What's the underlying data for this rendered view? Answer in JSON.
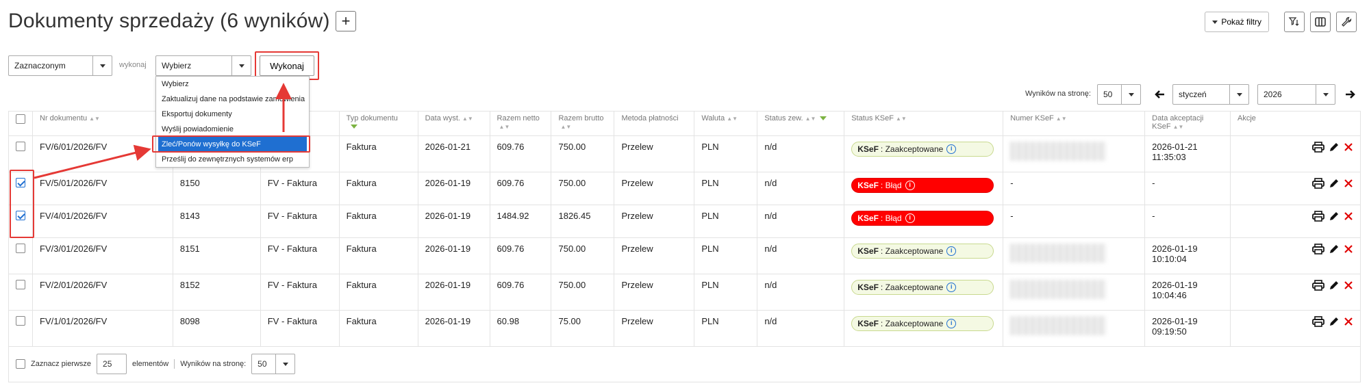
{
  "page": {
    "title": "Dokumenty sprzedaży (6 wyników)",
    "add_label": "+"
  },
  "top_right": {
    "filters_label": "Pokaż filtry"
  },
  "bulk": {
    "scope_value": "Zaznaczonym",
    "action_label": "wykonaj",
    "action_value": "Wybierz",
    "execute_label": "Wykonaj",
    "options": [
      "Wybierz",
      "Zaktualizuj dane na podstawie zamówienia",
      "Eksportuj dokumenty",
      "Wyślij powiadomienie",
      "Zleć/Ponów wysyłkę do KSeF",
      "Prześlij do zewnętrznych systemów erp"
    ],
    "active_option_index": 4
  },
  "pager": {
    "per_page_label": "Wyników na stronę:",
    "per_page_value": "50",
    "month": "styczeń",
    "year": "2026"
  },
  "table": {
    "headers": [
      "Nr dokumentu",
      "",
      "",
      "Typ dokumentu",
      "Data wyst.",
      "Razem netto",
      "Razem brutto",
      "Metoda płatności",
      "Waluta",
      "Status zew.",
      "Status KSeF",
      "Numer KSeF",
      "Data akceptacji KSeF",
      "Akcje"
    ],
    "rows": [
      {
        "checked": false,
        "nr": "FV/6/01/2026/FV",
        "id": "",
        "seria": "ura",
        "typ": "Faktura",
        "data": "2026-01-21",
        "netto": "609.76",
        "brutto": "750.00",
        "metoda": "Przelew",
        "waluta": "PLN",
        "status_zew": "n/d",
        "ksef_status": "ok",
        "ksef_prefix": "KSeF",
        "ksef_text": "Zaakceptowane",
        "numer": "",
        "akcept_date": "2026-01-21",
        "akcept_time": "11:35:03"
      },
      {
        "checked": true,
        "nr": "FV/5/01/2026/FV",
        "id": "8150",
        "seria": "FV - Faktura",
        "typ": "Faktura",
        "data": "2026-01-19",
        "netto": "609.76",
        "brutto": "750.00",
        "metoda": "Przelew",
        "waluta": "PLN",
        "status_zew": "n/d",
        "ksef_status": "err",
        "ksef_prefix": "KSeF",
        "ksef_text": "Błąd",
        "numer": "-",
        "akcept_date": "-",
        "akcept_time": ""
      },
      {
        "checked": true,
        "nr": "FV/4/01/2026/FV",
        "id": "8143",
        "seria": "FV - Faktura",
        "typ": "Faktura",
        "data": "2026-01-19",
        "netto": "1484.92",
        "brutto": "1826.45",
        "metoda": "Przelew",
        "waluta": "PLN",
        "status_zew": "n/d",
        "ksef_status": "err",
        "ksef_prefix": "KSeF",
        "ksef_text": "Błąd",
        "numer": "-",
        "akcept_date": "-",
        "akcept_time": ""
      },
      {
        "checked": false,
        "nr": "FV/3/01/2026/FV",
        "id": "8151",
        "seria": "FV - Faktura",
        "typ": "Faktura",
        "data": "2026-01-19",
        "netto": "609.76",
        "brutto": "750.00",
        "metoda": "Przelew",
        "waluta": "PLN",
        "status_zew": "n/d",
        "ksef_status": "ok",
        "ksef_prefix": "KSeF",
        "ksef_text": "Zaakceptowane",
        "numer": "",
        "akcept_date": "2026-01-19",
        "akcept_time": "10:10:04"
      },
      {
        "checked": false,
        "nr": "FV/2/01/2026/FV",
        "id": "8152",
        "seria": "FV - Faktura",
        "typ": "Faktura",
        "data": "2026-01-19",
        "netto": "609.76",
        "brutto": "750.00",
        "metoda": "Przelew",
        "waluta": "PLN",
        "status_zew": "n/d",
        "ksef_status": "ok",
        "ksef_prefix": "KSeF",
        "ksef_text": "Zaakceptowane",
        "numer": "",
        "akcept_date": "2026-01-19",
        "akcept_time": "10:04:46"
      },
      {
        "checked": false,
        "nr": "FV/1/01/2026/FV",
        "id": "8098",
        "seria": "FV - Faktura",
        "typ": "Faktura",
        "data": "2026-01-19",
        "netto": "60.98",
        "brutto": "75.00",
        "metoda": "Przelew",
        "waluta": "PLN",
        "status_zew": "n/d",
        "ksef_status": "ok",
        "ksef_prefix": "KSeF",
        "ksef_text": "Zaakceptowane",
        "numer": "",
        "akcept_date": "2026-01-19",
        "akcept_time": "09:19:50"
      }
    ]
  },
  "footer": {
    "select_first_label": "Zaznacz pierwsze",
    "select_first_value": "25",
    "elements_label": "elementów",
    "per_page_label": "Wyników na stronę:",
    "per_page_value": "50"
  },
  "colors": {
    "accent": "#1f6fd1",
    "annotation": "#e53935",
    "ksef_error": "#ff0000",
    "ksef_ok_bg": "#f4f9e3"
  }
}
